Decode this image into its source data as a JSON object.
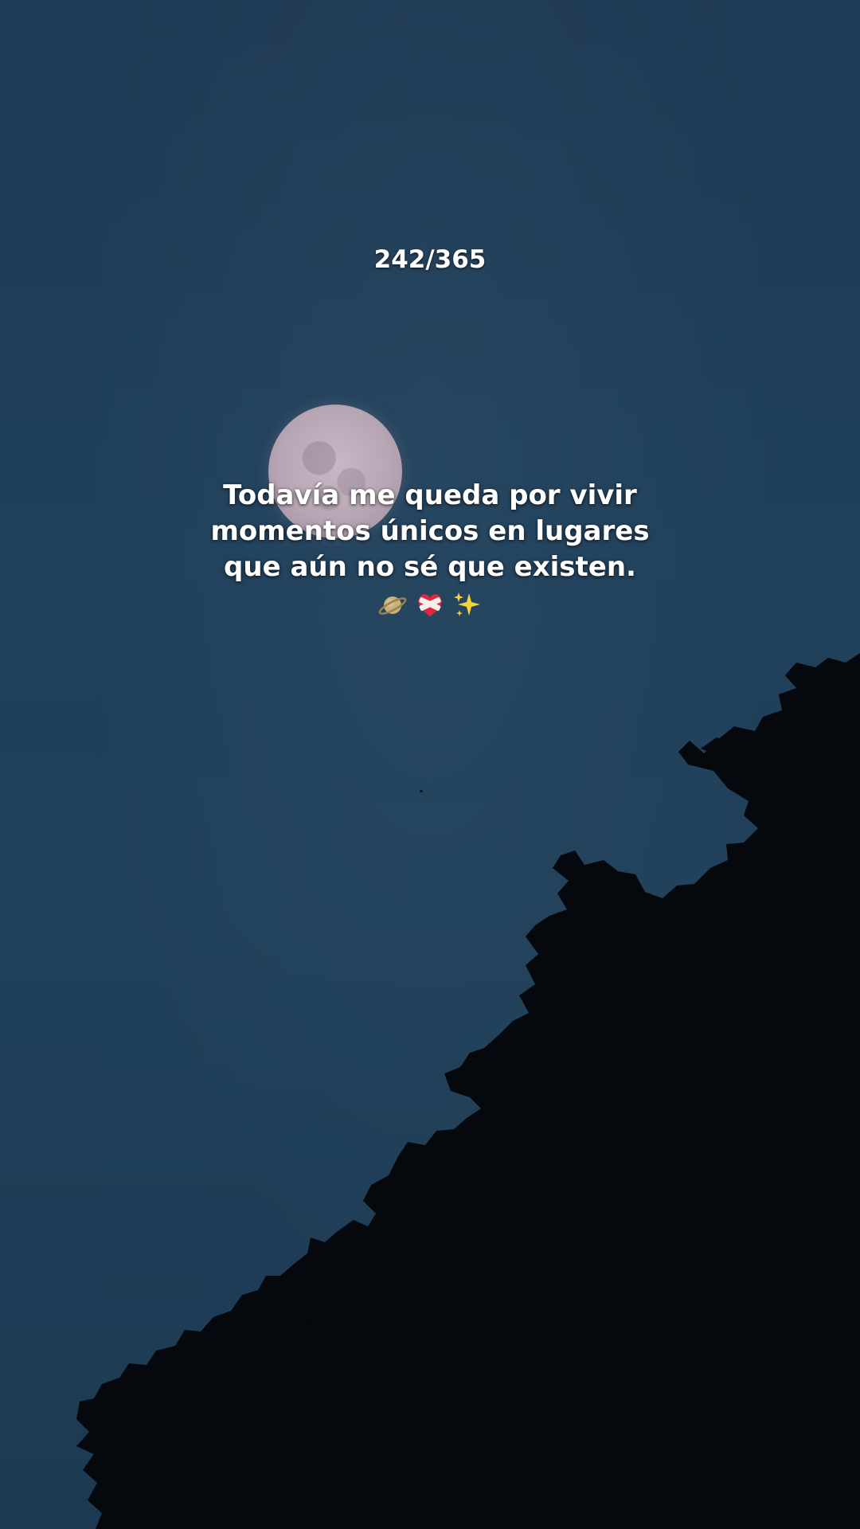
{
  "overlay": {
    "counter": "242/365",
    "caption_lines": [
      "Todavía me queda por vivir",
      "momentos únicos en lugares",
      "que aún no sé que existen."
    ],
    "emojis": [
      "ringed-planet",
      "mending-heart",
      "sparkles"
    ]
  },
  "colors": {
    "sky": "#20405b",
    "moon": "#bfaebc",
    "tree": "#05090d",
    "text": "#ffffff"
  }
}
